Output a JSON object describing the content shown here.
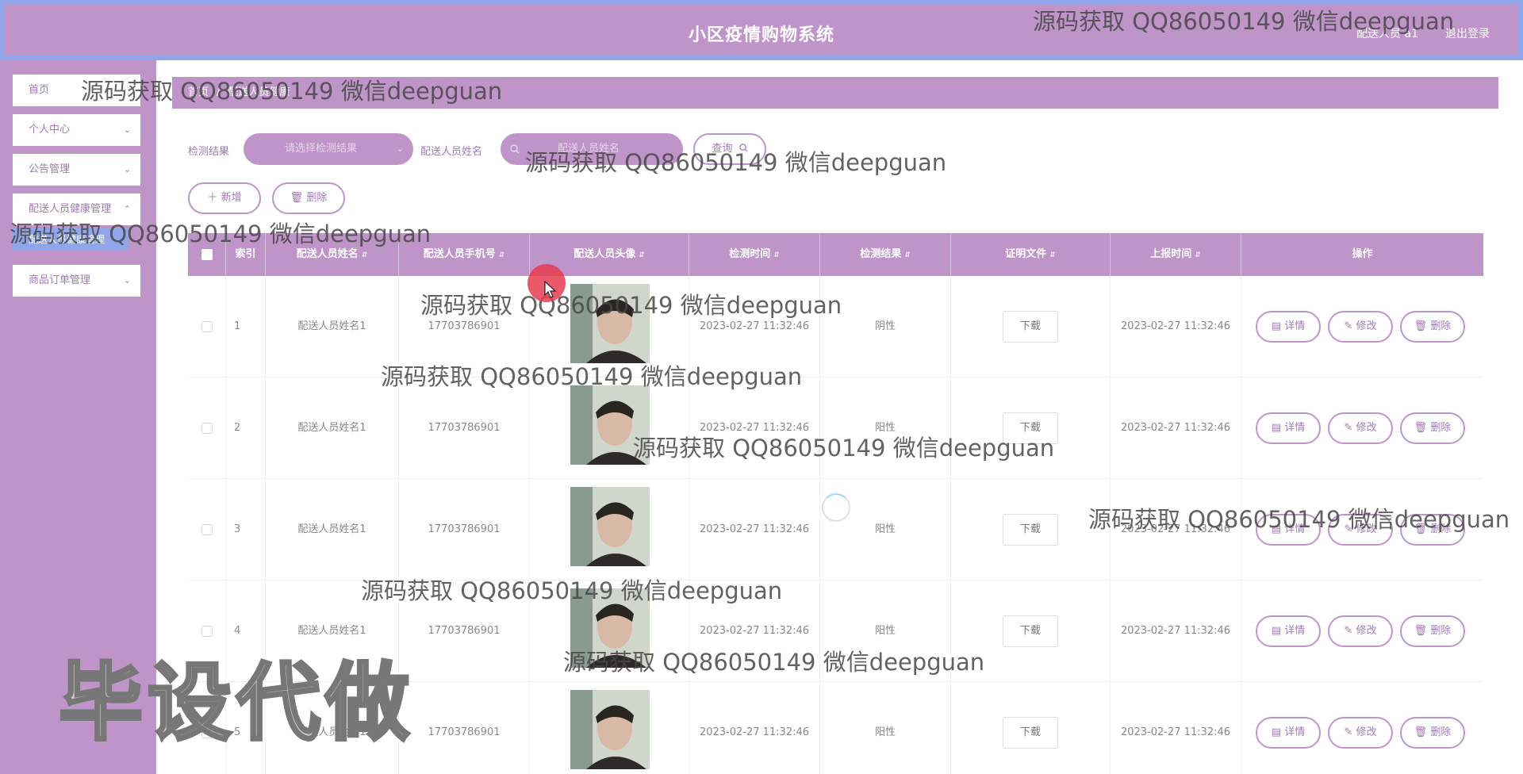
{
  "header": {
    "title": "小区疫情购物系统",
    "user": "配送人员 a1",
    "logout": "退出登录"
  },
  "sidebar": {
    "items": [
      {
        "label": "首页"
      },
      {
        "label": "个人中心"
      },
      {
        "label": "公告管理"
      },
      {
        "label": "配送人员健康管理"
      },
      {
        "label": "配送人员健康管理"
      },
      {
        "label": "商品订单管理"
      }
    ]
  },
  "breadcrumb": {
    "home": "首页",
    "current": "配送人员健康"
  },
  "search": {
    "result_label": "检测结果",
    "result_placeholder": "请选择检测结果",
    "name_label": "配送人员姓名",
    "name_placeholder": "配送人员姓名",
    "query_button": "查询"
  },
  "actions": {
    "add": "新增",
    "delete": "删除"
  },
  "table": {
    "columns": [
      "索引",
      "配送人员姓名",
      "配送人员手机号",
      "配送人员头像",
      "检测时间",
      "检测结果",
      "证明文件",
      "上报时间",
      "操作"
    ],
    "rows": [
      {
        "index": "1",
        "name": "配送人员姓名1",
        "phone": "17703786901",
        "time": "2023-02-27 11:32:46",
        "result": "阴性",
        "file": "下载",
        "report": "2023-02-27 11:32:46"
      },
      {
        "index": "2",
        "name": "配送人员姓名1",
        "phone": "17703786901",
        "time": "2023-02-27 11:32:46",
        "result": "阳性",
        "file": "下载",
        "report": "2023-02-27 11:32:46"
      },
      {
        "index": "3",
        "name": "配送人员姓名1",
        "phone": "17703786901",
        "time": "2023-02-27 11:32:46",
        "result": "阳性",
        "file": "下载",
        "report": "2023-02-27 11:32:46"
      },
      {
        "index": "4",
        "name": "配送人员姓名1",
        "phone": "17703786901",
        "time": "2023-02-27 11:32:46",
        "result": "阳性",
        "file": "下载",
        "report": "2023-02-27 11:32:46"
      },
      {
        "index": "5",
        "name": "配送人员姓名1",
        "phone": "17703786901",
        "time": "2023-02-27 11:32:46",
        "result": "阳性",
        "file": "下载",
        "report": "2023-02-27 11:32:46"
      }
    ],
    "row_actions": {
      "detail": "详情",
      "edit": "修改",
      "delete": "删除"
    }
  },
  "watermark": {
    "text": "源码获取 QQ86050149 微信deepguan",
    "big": "毕设代做"
  },
  "colors": {
    "primary": "#bf95c9",
    "border": "#8fa6ea"
  }
}
